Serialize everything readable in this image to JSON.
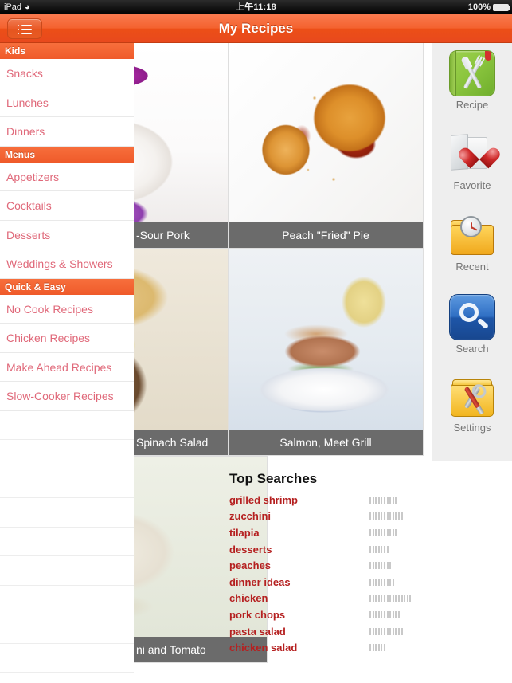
{
  "statusbar": {
    "device": "iPad",
    "wifi_icon": "wifi-icon",
    "time": "上午11:18",
    "battery_percent": "100%",
    "battery_icon": "battery-full-icon"
  },
  "navbar": {
    "title": "My Recipes",
    "menu_icon": "list-menu-icon"
  },
  "sidebar": {
    "sections": [
      {
        "header": "Kids",
        "items": [
          "Snacks",
          "Lunches",
          "Dinners"
        ]
      },
      {
        "header": "Menus",
        "items": [
          "Appetizers",
          "Cocktails",
          "Desserts",
          "Weddings & Showers"
        ]
      },
      {
        "header": "Quick & Easy",
        "items": [
          "No Cook Recipes",
          "Chicken Recipes",
          "Make Ahead Recipes",
          "Slow-Cooker Recipes"
        ]
      }
    ],
    "empty_rows": 9
  },
  "recipes": [
    {
      "title": "-Sour Pork",
      "photo": "sweet-sour-pork",
      "clipped": true
    },
    {
      "title": "Peach \"Fried\" Pie",
      "photo": "peach-fried-pie",
      "clipped": false
    },
    {
      "title": "Spinach Salad",
      "photo": "spinach-salad",
      "clipped": true
    },
    {
      "title": "Salmon, Meet Grill",
      "photo": "salmon-burger",
      "clipped": false
    },
    {
      "title": "ni and Tomato",
      "photo": "zucchini-tomato",
      "clipped": true
    }
  ],
  "top_searches": {
    "title": "Top Searches",
    "items": [
      {
        "term": "grilled shrimp",
        "count": 10
      },
      {
        "term": "zucchini",
        "count": 12
      },
      {
        "term": "tilapia",
        "count": 10
      },
      {
        "term": "desserts",
        "count": 7
      },
      {
        "term": "peaches",
        "count": 8
      },
      {
        "term": "dinner ideas",
        "count": 9
      },
      {
        "term": "chicken",
        "count": 15
      },
      {
        "term": "pork chops",
        "count": 11
      },
      {
        "term": "pasta salad",
        "count": 12
      },
      {
        "term": "chicken salad",
        "count": 6
      }
    ]
  },
  "rail": {
    "items": [
      {
        "label": "Recipe",
        "icon": "recipe-book-icon"
      },
      {
        "label": "Favorite",
        "icon": "favorite-heart-folder-icon"
      },
      {
        "label": "Recent",
        "icon": "recent-clock-folder-icon"
      },
      {
        "label": "Search",
        "icon": "search-magnifier-icon"
      },
      {
        "label": "Settings",
        "icon": "settings-tools-folder-icon"
      }
    ]
  },
  "colors": {
    "accent_orange": "#ef5a2a",
    "sidebar_text": "#e0697a",
    "search_term_red": "#b52020",
    "caption_gray": "#6b6b6b",
    "rail_bg": "#eeeeee"
  }
}
